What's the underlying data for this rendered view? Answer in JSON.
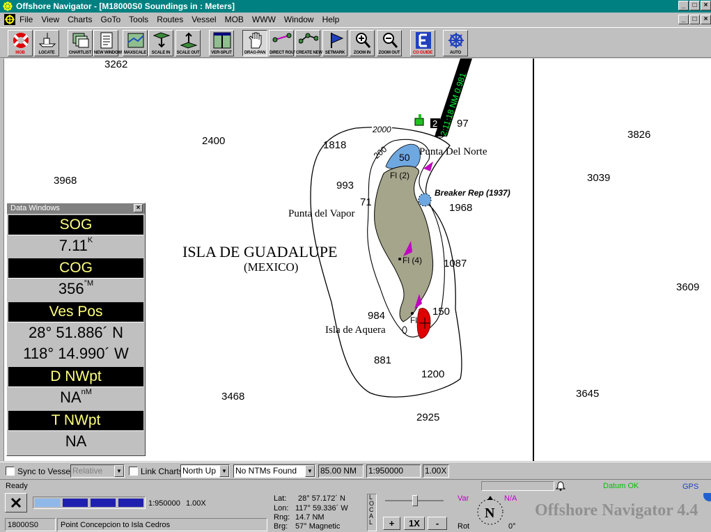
{
  "window": {
    "title": "Offshore Navigator - [M18000S0 Soundings in : Meters]",
    "minimize": "_",
    "maximize": "□",
    "close": "×"
  },
  "menu": [
    "File",
    "View",
    "Charts",
    "GoTo",
    "Tools",
    "Routes",
    "Vessel",
    "MOB",
    "WWW",
    "Window",
    "Help"
  ],
  "toolbar": {
    "mob": "MOB",
    "locate": "LOCATE",
    "chartlist": "CHARTLIST",
    "newwindow": "NEW WINDOW",
    "maxscale": "MAXSCALE",
    "scalein": "SCALE IN",
    "scaleout": "SCALE OUT",
    "versplit": "VER-SPLIT",
    "dragpan": "DRAG-PAN",
    "directroute": "DIRECT ROUTE",
    "createnewroute": "CREATE NEW ROUTE",
    "setmark": "SETMARK",
    "zoomin": "ZOOM IN",
    "zoomout": "ZOOM OUT",
    "coguide": "CO GUIDE",
    "auto": "AUTO"
  },
  "chart": {
    "soundings": [
      "3262",
      "2400",
      "3968",
      "1818",
      "993",
      "71",
      "1968",
      "1087",
      "984",
      "150",
      "881",
      "1200",
      "3468",
      "2925",
      "3826",
      "3039",
      "3609",
      "3645",
      "97"
    ],
    "contours": [
      "2000",
      "200",
      "50"
    ],
    "island_name": "ISLA DE GUADALUPE",
    "country": "(MEXICO)",
    "places": {
      "north_point": "Punta Del Norte",
      "vapor_point": "Punta del Vapor",
      "aquera": "Isla de Aquera",
      "breaker": "Breaker Rep (1937)"
    },
    "lights": [
      "Fl (2)",
      "Fl (4)",
      "Fl"
    ],
    "buoy_number": "2",
    "vector_label": "2:11:18 NM 0.981",
    "colors": {
      "land": "#a5a58c",
      "shoal": "#6fa8e0",
      "light": "#c000c0",
      "vessel": "#e00000",
      "vector": "#000000",
      "vector_text": "#00ff40"
    }
  },
  "data_window": {
    "title": "Data Windows",
    "sog_label": "SOG",
    "sog_value": "7.11",
    "sog_unit": "K",
    "cog_label": "COG",
    "cog_value": "356",
    "cog_unit": "°M",
    "vespos_label": "Ves Pos",
    "lat": "28° 51.886´ N",
    "lon": "118° 14.990´ W",
    "dnwpt_label": "D NWpt",
    "dnwpt_value": "NA",
    "dnwpt_unit": "nM",
    "tnwpt_label": "T NWpt",
    "tnwpt_value": "NA"
  },
  "options": {
    "sync_label": "Sync to Vessel",
    "relative": "Relative",
    "link_label": "Link Charts",
    "orientation": "North Up",
    "ntm": "No NTMs Found",
    "range": "85.00 NM",
    "scale": "1:950000",
    "zoom": "1.00X"
  },
  "status": {
    "ready": "Ready",
    "datum": "Datum OK",
    "gps": "GPS",
    "scale": "1:950000",
    "zoom": "1.00X",
    "lat_label": "Lat:",
    "lat": "28° 57.172´ N",
    "lon_label": "Lon:",
    "lon": "117° 59.336´ W",
    "rng_label": "Rng:",
    "rng": "14.7 NM",
    "brg_label": "Brg:",
    "brg": "57° Magnetic",
    "local": "LOCAL",
    "plus": "+",
    "onex": "1X",
    "minus": "-",
    "var_label": "Var",
    "var_value": "N/A",
    "rot_label": "Rot",
    "rot_value": "0°",
    "compass": "N",
    "brand": "Offshore Navigator 4.4",
    "chart_id": "18000S0",
    "chart_name": "Point Concepcion to Isla Cedros"
  }
}
